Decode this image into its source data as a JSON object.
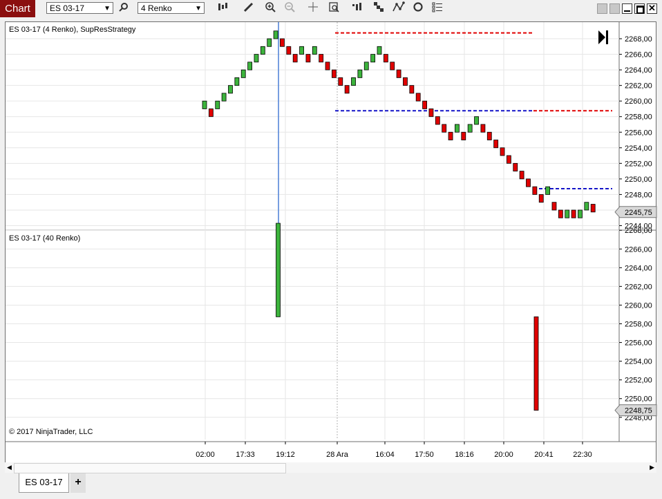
{
  "toolbar": {
    "title": "Chart",
    "instrument": "ES 03-17",
    "bar_type": "4 Renko",
    "icons": [
      "search-icon",
      "bar-style-icon",
      "pencil-icon",
      "zoom-in-icon",
      "zoom-out-icon",
      "crosshair-icon",
      "data-box-icon",
      "bar-indicator-icon",
      "strategy-icon",
      "chart-trader-icon",
      "refresh-icon",
      "properties-icon"
    ]
  },
  "upper_panel": {
    "label": "ES 03-17 (4 Renko), SupResStrategy",
    "price_ticks": [
      "2268,00",
      "2266,00",
      "2264,00",
      "2262,00",
      "2260,00",
      "2258,00",
      "2256,00",
      "2254,00",
      "2252,00",
      "2250,00",
      "2248,00",
      "2246,00",
      "2244,00"
    ],
    "current_price": "2245,75"
  },
  "lower_panel": {
    "label": "ES 03-17 (40 Renko)",
    "price_ticks": [
      "2268,00",
      "2266,00",
      "2264,00",
      "2262,00",
      "2260,00",
      "2258,00",
      "2256,00",
      "2254,00",
      "2252,00",
      "2250,00",
      "2248,00"
    ],
    "current_price": "2248,75",
    "copyright": "© 2017 NinjaTrader, LLC"
  },
  "time_axis": [
    "02:00",
    "17:33",
    "19:12",
    "28 Ara",
    "16:04",
    "17:50",
    "18:16",
    "20:00",
    "20:41",
    "22:30"
  ],
  "colors": {
    "up": "#3cb33c",
    "down": "#e00000",
    "support": "#1414c8",
    "resistance": "#e00000",
    "crosshair": "#4a7fd6"
  },
  "bottom_tabs": {
    "active": "ES 03-17",
    "add": "+"
  },
  "chart_data": {
    "type": "candlestick",
    "upper_bricks": [
      {
        "open": 2259,
        "close": 2260,
        "dir": "up"
      },
      {
        "open": 2258,
        "close": 2259,
        "dir": "down"
      },
      {
        "open": 2259,
        "close": 2260,
        "dir": "up"
      },
      {
        "open": 2260,
        "close": 2261,
        "dir": "up"
      },
      {
        "open": 2261,
        "close": 2262,
        "dir": "up"
      },
      {
        "open": 2262,
        "close": 2263,
        "dir": "up"
      },
      {
        "open": 2263,
        "close": 2264,
        "dir": "up"
      },
      {
        "open": 2264,
        "close": 2265,
        "dir": "up"
      },
      {
        "open": 2265,
        "close": 2266,
        "dir": "up"
      },
      {
        "open": 2266,
        "close": 2267,
        "dir": "up"
      },
      {
        "open": 2267,
        "close": 2268,
        "dir": "up"
      },
      {
        "open": 2268,
        "close": 2269,
        "dir": "up"
      },
      {
        "open": 2267,
        "close": 2268,
        "dir": "down"
      },
      {
        "open": 2266,
        "close": 2267,
        "dir": "down"
      },
      {
        "open": 2265,
        "close": 2266,
        "dir": "down"
      },
      {
        "open": 2266,
        "close": 2267,
        "dir": "up"
      },
      {
        "open": 2265,
        "close": 2266,
        "dir": "down"
      },
      {
        "open": 2266,
        "close": 2267,
        "dir": "up"
      },
      {
        "open": 2265,
        "close": 2266,
        "dir": "down"
      },
      {
        "open": 2264,
        "close": 2265,
        "dir": "down"
      },
      {
        "open": 2263,
        "close": 2264,
        "dir": "down"
      },
      {
        "open": 2262,
        "close": 2263,
        "dir": "down"
      },
      {
        "open": 2261,
        "close": 2262,
        "dir": "down"
      },
      {
        "open": 2262,
        "close": 2263,
        "dir": "up"
      },
      {
        "open": 2263,
        "close": 2264,
        "dir": "up"
      },
      {
        "open": 2264,
        "close": 2265,
        "dir": "up"
      },
      {
        "open": 2265,
        "close": 2266,
        "dir": "up"
      },
      {
        "open": 2266,
        "close": 2267,
        "dir": "up"
      },
      {
        "open": 2265,
        "close": 2266,
        "dir": "down"
      },
      {
        "open": 2264,
        "close": 2265,
        "dir": "down"
      },
      {
        "open": 2263,
        "close": 2264,
        "dir": "down"
      },
      {
        "open": 2262,
        "close": 2263,
        "dir": "down"
      },
      {
        "open": 2261,
        "close": 2262,
        "dir": "down"
      },
      {
        "open": 2260,
        "close": 2261,
        "dir": "down"
      },
      {
        "open": 2259,
        "close": 2260,
        "dir": "down"
      },
      {
        "open": 2258,
        "close": 2259,
        "dir": "down"
      },
      {
        "open": 2257,
        "close": 2258,
        "dir": "down"
      },
      {
        "open": 2256,
        "close": 2257,
        "dir": "down"
      },
      {
        "open": 2255,
        "close": 2256,
        "dir": "down"
      },
      {
        "open": 2256,
        "close": 2257,
        "dir": "up"
      },
      {
        "open": 2255,
        "close": 2256,
        "dir": "down"
      },
      {
        "open": 2256,
        "close": 2257,
        "dir": "up"
      },
      {
        "open": 2257,
        "close": 2258,
        "dir": "up"
      },
      {
        "open": 2256,
        "close": 2257,
        "dir": "down"
      },
      {
        "open": 2255,
        "close": 2256,
        "dir": "down"
      },
      {
        "open": 2254,
        "close": 2255,
        "dir": "down"
      },
      {
        "open": 2253,
        "close": 2254,
        "dir": "down"
      },
      {
        "open": 2252,
        "close": 2253,
        "dir": "down"
      },
      {
        "open": 2251,
        "close": 2252,
        "dir": "down"
      },
      {
        "open": 2250,
        "close": 2251,
        "dir": "down"
      },
      {
        "open": 2249,
        "close": 2250,
        "dir": "down"
      },
      {
        "open": 2248,
        "close": 2249,
        "dir": "down"
      },
      {
        "open": 2247,
        "close": 2248,
        "dir": "down"
      },
      {
        "open": 2248,
        "close": 2249,
        "dir": "up"
      },
      {
        "open": 2246,
        "close": 2247,
        "dir": "down"
      },
      {
        "open": 2245,
        "close": 2246,
        "dir": "down"
      },
      {
        "open": 2245,
        "close": 2246,
        "dir": "up"
      },
      {
        "open": 2245,
        "close": 2246,
        "dir": "down"
      },
      {
        "open": 2245,
        "close": 2246,
        "dir": "up"
      },
      {
        "open": 2246,
        "close": 2247,
        "dir": "up"
      },
      {
        "open": 2245.75,
        "close": 2246.75,
        "dir": "down"
      }
    ],
    "lower_bricks": [
      {
        "open": 2258.75,
        "close": 2268.75,
        "dir": "up"
      },
      {
        "open": 2248.75,
        "close": 2258.75,
        "dir": "down"
      }
    ],
    "resistance_levels": [
      2268.75,
      2258.75
    ],
    "support_levels": [
      2258.75,
      2248.75
    ]
  }
}
